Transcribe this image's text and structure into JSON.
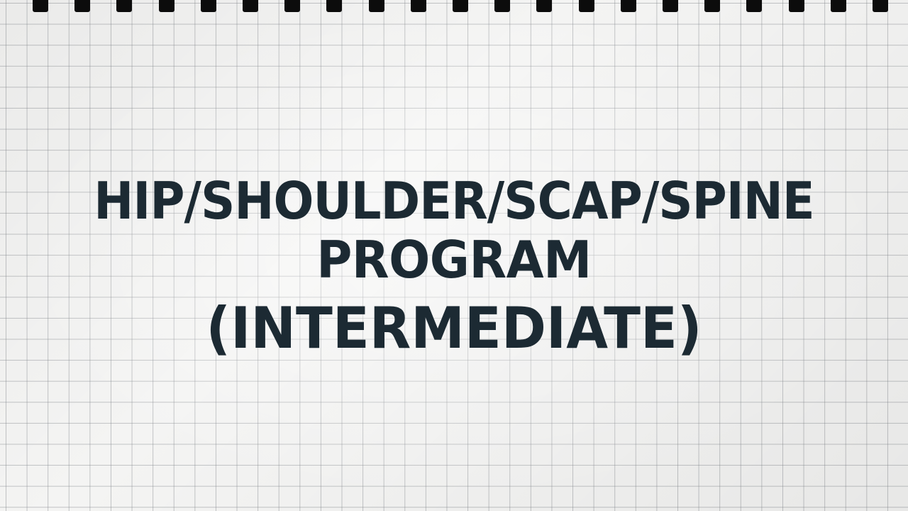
{
  "title": {
    "line1": "HIP/SHOULDER/SCAP/SPINE",
    "line2": "PROGRAM",
    "line3": "(INTERMEDIATE)"
  },
  "colors": {
    "paper": "#f4f4f3",
    "grid": "#787c82",
    "text": "#1c2a33",
    "spiral": "#0c0c0c"
  },
  "decor": {
    "background": "graph-paper-grid",
    "binding": "spiral-binding-holes"
  }
}
